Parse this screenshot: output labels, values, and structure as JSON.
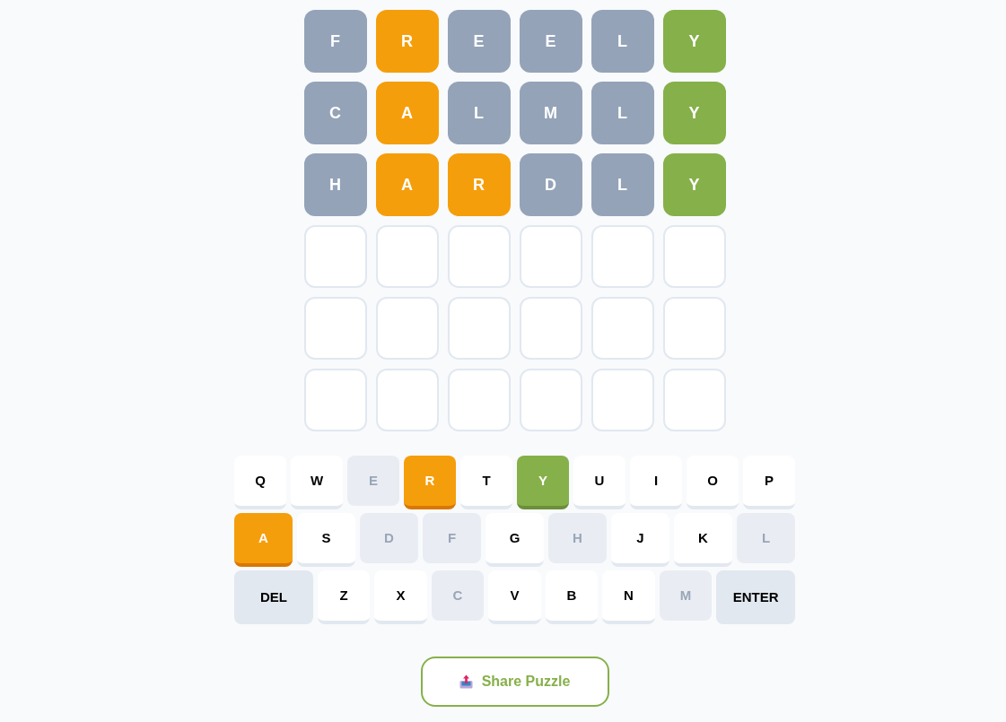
{
  "board": {
    "rows": [
      {
        "tiles": [
          {
            "letter": "F",
            "kind": "absent"
          },
          {
            "letter": "R",
            "kind": "present"
          },
          {
            "letter": "E",
            "kind": "absent"
          },
          {
            "letter": "E",
            "kind": "absent"
          },
          {
            "letter": "L",
            "kind": "absent"
          },
          {
            "letter": "Y",
            "kind": "correct"
          }
        ]
      },
      {
        "tiles": [
          {
            "letter": "C",
            "kind": "absent"
          },
          {
            "letter": "A",
            "kind": "present"
          },
          {
            "letter": "L",
            "kind": "absent"
          },
          {
            "letter": "M",
            "kind": "absent"
          },
          {
            "letter": "L",
            "kind": "absent"
          },
          {
            "letter": "Y",
            "kind": "correct"
          }
        ]
      },
      {
        "tiles": [
          {
            "letter": "H",
            "kind": "absent"
          },
          {
            "letter": "A",
            "kind": "present"
          },
          {
            "letter": "R",
            "kind": "present"
          },
          {
            "letter": "D",
            "kind": "absent"
          },
          {
            "letter": "L",
            "kind": "absent"
          },
          {
            "letter": "Y",
            "kind": "correct"
          }
        ]
      },
      {
        "tiles": [
          {
            "kind": "empty"
          },
          {
            "kind": "empty"
          },
          {
            "kind": "empty"
          },
          {
            "kind": "empty"
          },
          {
            "kind": "empty"
          },
          {
            "kind": "empty"
          }
        ]
      },
      {
        "tiles": [
          {
            "kind": "empty"
          },
          {
            "kind": "empty"
          },
          {
            "kind": "empty"
          },
          {
            "kind": "empty"
          },
          {
            "kind": "empty"
          },
          {
            "kind": "empty"
          }
        ]
      },
      {
        "tiles": [
          {
            "kind": "empty"
          },
          {
            "kind": "empty"
          },
          {
            "kind": "empty"
          },
          {
            "kind": "empty"
          },
          {
            "kind": "empty"
          },
          {
            "kind": "empty"
          }
        ]
      }
    ]
  },
  "keyboard": {
    "rows": [
      {
        "keys": [
          {
            "label": "Q",
            "kind": "unused"
          },
          {
            "label": "W",
            "kind": "unused"
          },
          {
            "label": "E",
            "kind": "absent"
          },
          {
            "label": "R",
            "kind": "present"
          },
          {
            "label": "T",
            "kind": "unused"
          },
          {
            "label": "Y",
            "kind": "correct"
          },
          {
            "label": "U",
            "kind": "unused"
          },
          {
            "label": "I",
            "kind": "unused"
          },
          {
            "label": "O",
            "kind": "unused"
          },
          {
            "label": "P",
            "kind": "unused"
          }
        ]
      },
      {
        "keys": [
          {
            "label": "A",
            "kind": "present"
          },
          {
            "label": "S",
            "kind": "unused"
          },
          {
            "label": "D",
            "kind": "absent"
          },
          {
            "label": "F",
            "kind": "absent"
          },
          {
            "label": "G",
            "kind": "unused"
          },
          {
            "label": "H",
            "kind": "absent"
          },
          {
            "label": "J",
            "kind": "unused"
          },
          {
            "label": "K",
            "kind": "unused"
          },
          {
            "label": "L",
            "kind": "absent"
          }
        ]
      },
      {
        "keys": [
          {
            "label": "DEL",
            "kind": "action"
          },
          {
            "label": "Z",
            "kind": "unused"
          },
          {
            "label": "X",
            "kind": "unused"
          },
          {
            "label": "C",
            "kind": "absent"
          },
          {
            "label": "V",
            "kind": "unused"
          },
          {
            "label": "B",
            "kind": "unused"
          },
          {
            "label": "N",
            "kind": "unused"
          },
          {
            "label": "M",
            "kind": "absent"
          },
          {
            "label": "ENTER",
            "kind": "action"
          }
        ]
      }
    ]
  },
  "share_button": {
    "label": "Share Puzzle"
  }
}
